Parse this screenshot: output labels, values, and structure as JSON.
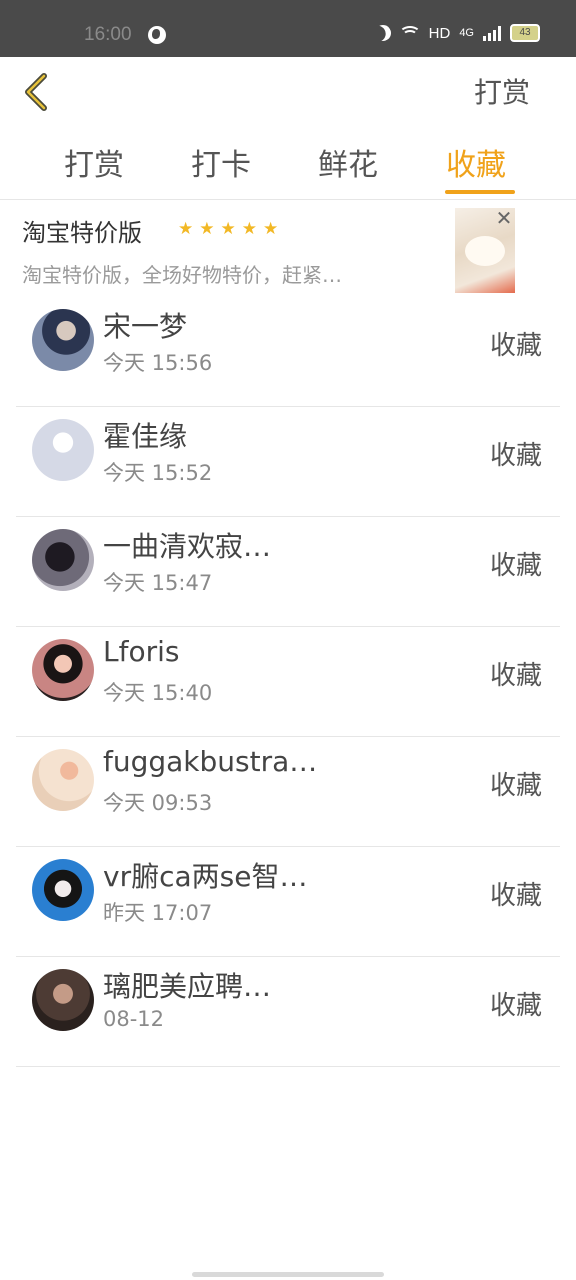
{
  "status_bar": {
    "time": "16:00",
    "network": "HD",
    "network_type": "4G",
    "battery": "43"
  },
  "header": {
    "back_icon": "chevron-left-icon",
    "action_label": "打赏"
  },
  "tabs": [
    {
      "label": "打赏",
      "active": false
    },
    {
      "label": "打卡",
      "active": false
    },
    {
      "label": "鲜花",
      "active": false
    },
    {
      "label": "收藏",
      "active": true
    }
  ],
  "ad": {
    "title": "淘宝特价版",
    "rating_stars": 5,
    "description": "淘宝特价版，全场好物特价，赶紧…",
    "close_icon": "close-icon"
  },
  "items": [
    {
      "name": "宋一梦",
      "time": "今天 15:56",
      "action": "收藏"
    },
    {
      "name": "霍佳缘",
      "time": "今天 15:52",
      "action": "收藏"
    },
    {
      "name": "一曲清欢寂…",
      "time": "今天 15:47",
      "action": "收藏"
    },
    {
      "name": "Lforis",
      "time": "今天 15:40",
      "action": "收藏"
    },
    {
      "name": "fuggakbustra…",
      "time": "今天 09:53",
      "action": "收藏"
    },
    {
      "name": "vr腑ca两se智…",
      "time": "昨天 17:07",
      "action": "收藏"
    },
    {
      "name": "璃肥美应聘…",
      "time": "08-12",
      "action": "收藏"
    }
  ],
  "colors": {
    "accent": "#f0a21a",
    "star": "#f2b825",
    "status_bar": "#4a4a4a"
  }
}
